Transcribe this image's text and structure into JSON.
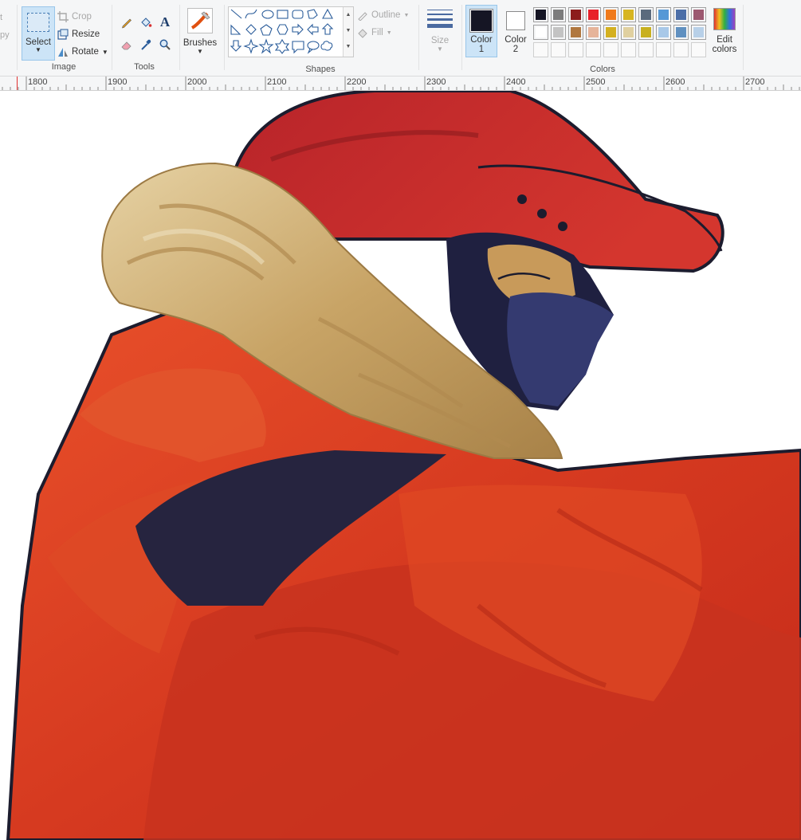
{
  "ribbon": {
    "clipboard": {
      "partial_label": "py",
      "partial_label_top": "t"
    },
    "image": {
      "group_label": "Image",
      "select_label": "Select",
      "crop_label": "Crop",
      "resize_label": "Resize",
      "rotate_label": "Rotate"
    },
    "tools": {
      "group_label": "Tools",
      "text_glyph": "A"
    },
    "brushes": {
      "label": "Brushes"
    },
    "shapes": {
      "group_label": "Shapes",
      "outline_label": "Outline",
      "fill_label": "Fill"
    },
    "size": {
      "label": "Size"
    },
    "colors": {
      "group_label": "Colors",
      "color1_label": "Color",
      "color1_num": "1",
      "color2_label": "Color",
      "color2_num": "2",
      "color1_value": "#151524",
      "color2_value": "#ffffff",
      "edit_label_1": "Edit",
      "edit_label_2": "colors",
      "palette_row1": [
        "#151524",
        "#7c7c7c",
        "#8c1c1c",
        "#e8202a",
        "#f07a1c",
        "#d7b520",
        "#5a6a7d",
        "#5598d6",
        "#4b6ea8",
        "#9c5870"
      ],
      "palette_row2": [
        "#ffffff",
        "#c3c3c3",
        "#b07840",
        "#e6b49a",
        "#d4b020",
        "#e0d0a0",
        "#c8b020",
        "#a8c8e8",
        "#6090c0",
        "#b8d0e8"
      ]
    }
  },
  "ruler": {
    "ticks": [
      "1800",
      "1900",
      "2000",
      "2100",
      "2200",
      "2300",
      "2400",
      "2500",
      "2600",
      "2700"
    ]
  }
}
